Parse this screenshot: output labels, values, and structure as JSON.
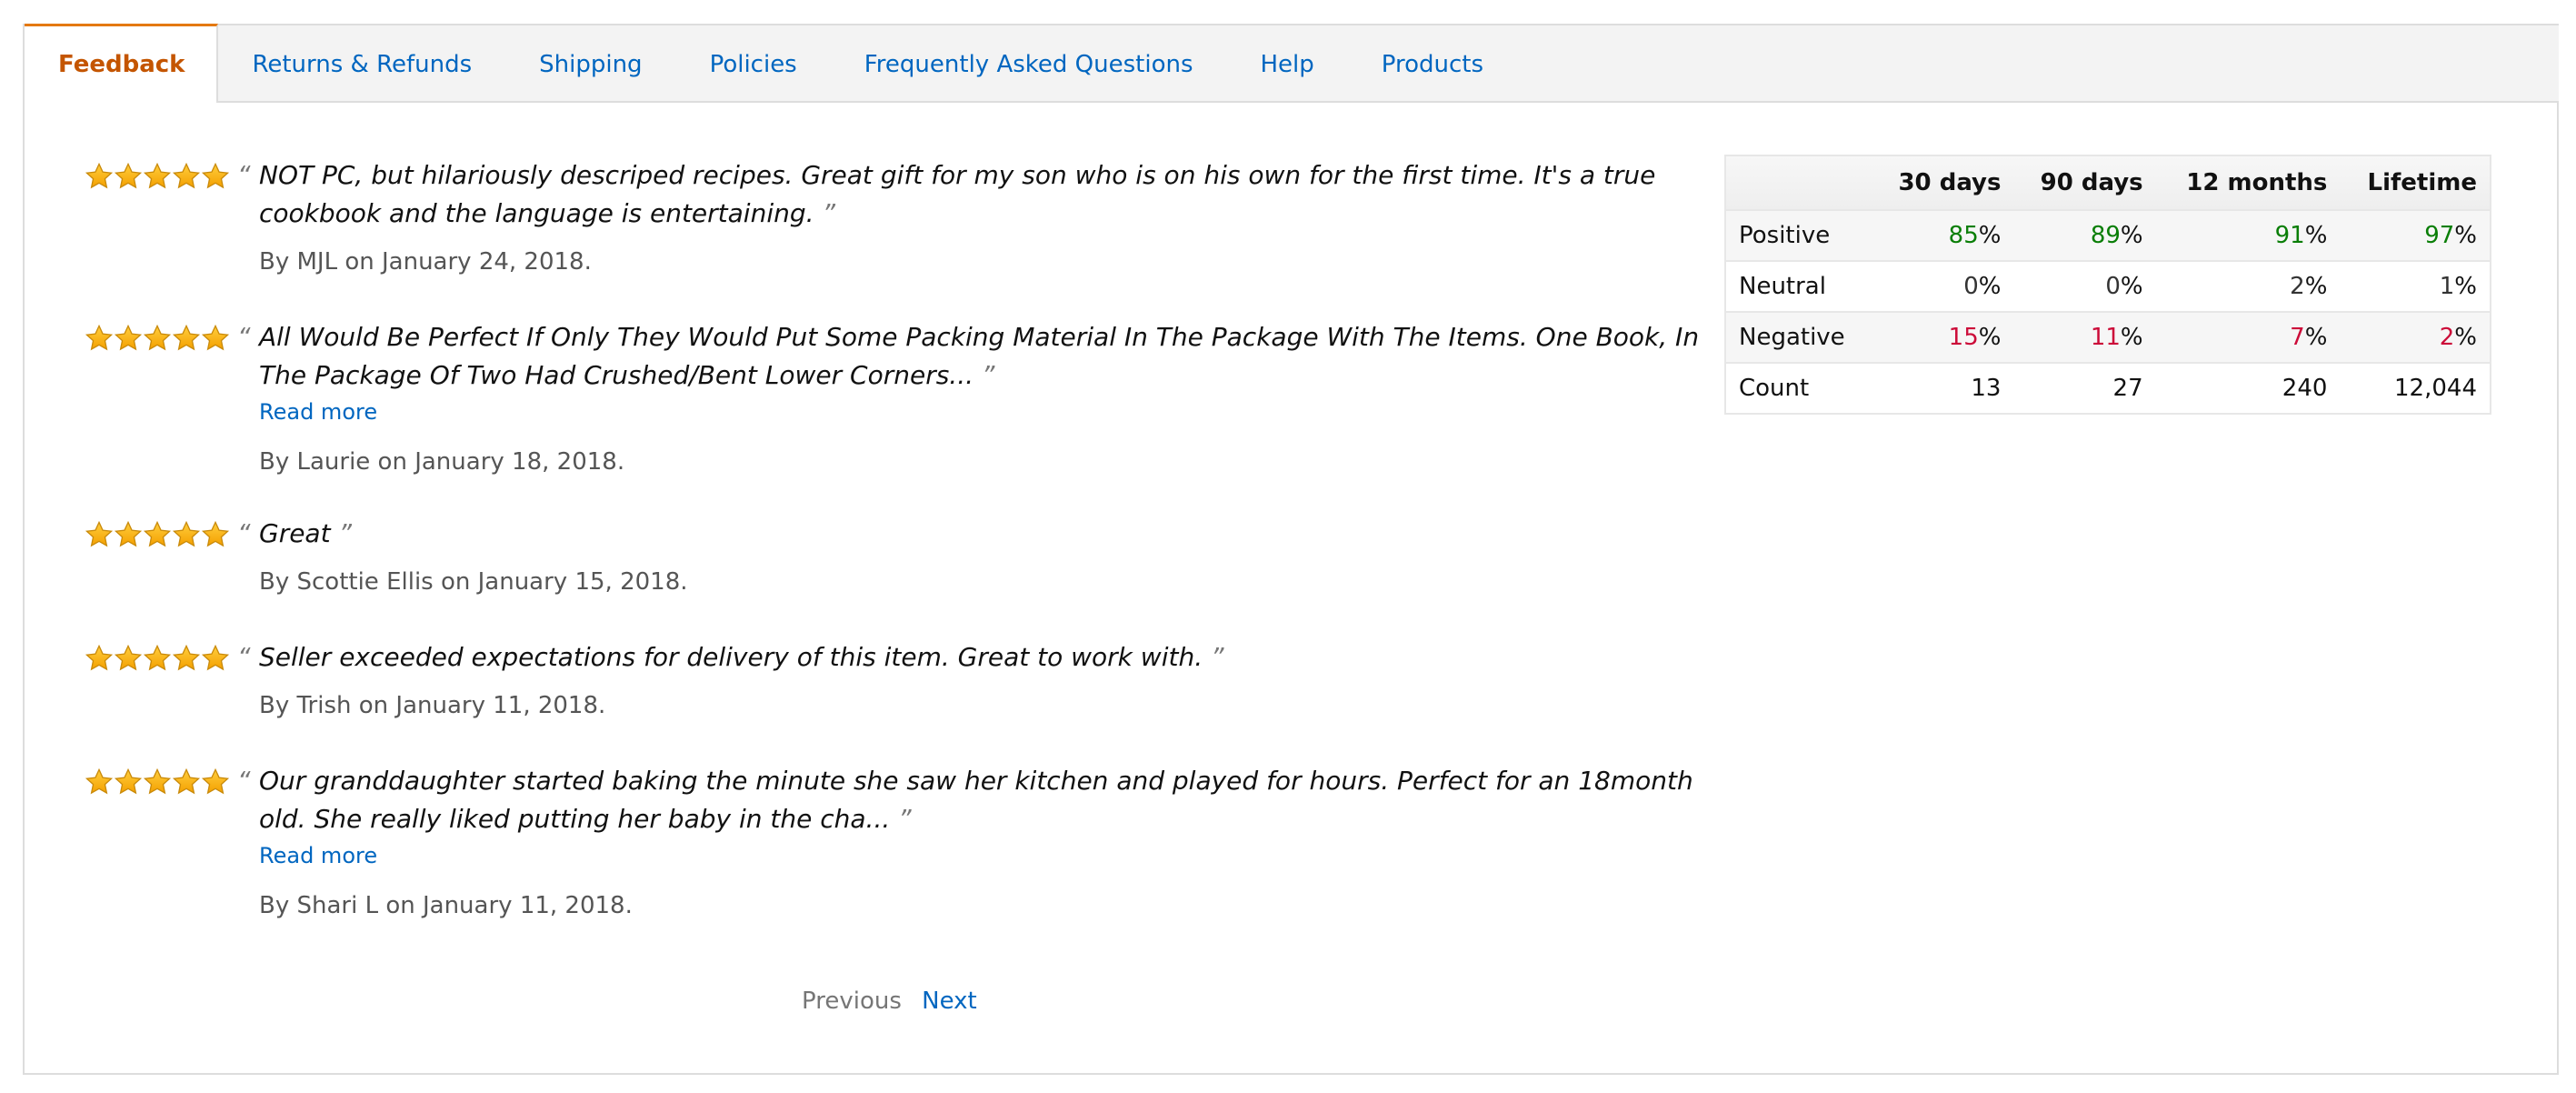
{
  "tabs": [
    {
      "label": "Feedback",
      "active": true
    },
    {
      "label": "Returns & Refunds",
      "active": false
    },
    {
      "label": "Shipping",
      "active": false
    },
    {
      "label": "Policies",
      "active": false
    },
    {
      "label": "Frequently Asked Questions",
      "active": false
    },
    {
      "label": "Help",
      "active": false
    },
    {
      "label": "Products",
      "active": false
    }
  ],
  "quote_marks": {
    "open": "“",
    "close": "”"
  },
  "reviews": [
    {
      "rating": 5,
      "text": "NOT PC, but hilariously descriped recipes. Great gift for my son who is on his own for the first time. It's a true cookbook and the language is entertaining.",
      "read_more": null,
      "byline": "By MJL on January 24, 2018."
    },
    {
      "rating": 5,
      "text": "All Would Be Perfect If Only They Would Put Some Packing Material In The Package With The Items. One Book, In The Package Of Two Had Crushed/Bent Lower Corners...",
      "read_more": "Read more",
      "byline": "By Laurie on January 18, 2018."
    },
    {
      "rating": 5,
      "text": "Great",
      "read_more": null,
      "byline": "By Scottie Ellis on January 15, 2018."
    },
    {
      "rating": 5,
      "text": "Seller exceeded expectations for delivery of this item. Great to work with.",
      "read_more": null,
      "byline": "By Trish on January 11, 2018."
    },
    {
      "rating": 5,
      "text": "Our granddaughter started baking the minute she saw her kitchen and played for hours. Perfect for an 18month old. She really liked putting her baby in the cha...",
      "read_more": "Read more",
      "byline": "By Shari L on January 11, 2018."
    }
  ],
  "pagination": {
    "previous": "Previous",
    "next": "Next"
  },
  "stats": {
    "headers": [
      "",
      "30 days",
      "90 days",
      "12 months",
      "Lifetime"
    ],
    "rows": [
      {
        "label": "Positive",
        "values": [
          "85",
          "89",
          "91",
          "97"
        ],
        "suffix": "%",
        "tone": "pos"
      },
      {
        "label": "Neutral",
        "values": [
          "0",
          "0",
          "2",
          "1"
        ],
        "suffix": "%",
        "tone": "neu"
      },
      {
        "label": "Negative",
        "values": [
          "15",
          "11",
          "7",
          "2"
        ],
        "suffix": "%",
        "tone": "neg"
      },
      {
        "label": "Count",
        "values": [
          "13",
          "27",
          "240",
          "12,044"
        ],
        "suffix": "",
        "tone": "plain"
      }
    ]
  },
  "colors": {
    "active_tab": "#c45500",
    "active_tab_border": "#e47911",
    "link": "#0066c0",
    "positive": "#0a7e07",
    "negative": "#cc0c39",
    "star_fill": "#ffa41c"
  }
}
